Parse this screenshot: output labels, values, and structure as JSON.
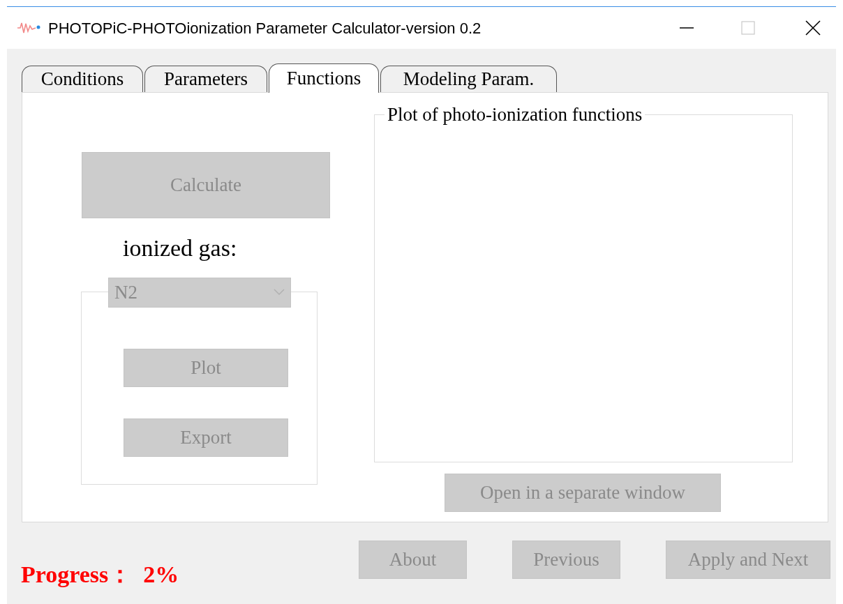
{
  "window": {
    "title": "PHOTOPiC-PHOTOionization Parameter Calculator-version 0.2"
  },
  "tabs": [
    {
      "label": "Conditions",
      "selected": false
    },
    {
      "label": "Parameters",
      "selected": false
    },
    {
      "label": "Functions",
      "selected": true
    },
    {
      "label": "Modeling Param.",
      "selected": false
    }
  ],
  "calculate_button": {
    "label": "Calculate",
    "disabled": true
  },
  "gas": {
    "label": "ionized gas:",
    "value": "N2",
    "disabled": true
  },
  "gas_buttons": [
    {
      "label": "Plot",
      "disabled": true
    },
    {
      "label": "Export",
      "disabled": true
    }
  ],
  "plot_group": {
    "title": "Plot of photo-ionization functions"
  },
  "open_button": {
    "label": "Open in a separate window",
    "disabled": true
  },
  "progress": {
    "label": "Progress：",
    "value": "2%"
  },
  "footer_buttons": [
    {
      "label": "About",
      "disabled": true
    },
    {
      "label": "Previous",
      "disabled": true
    },
    {
      "label": "Apply and Next",
      "disabled": true
    }
  ]
}
